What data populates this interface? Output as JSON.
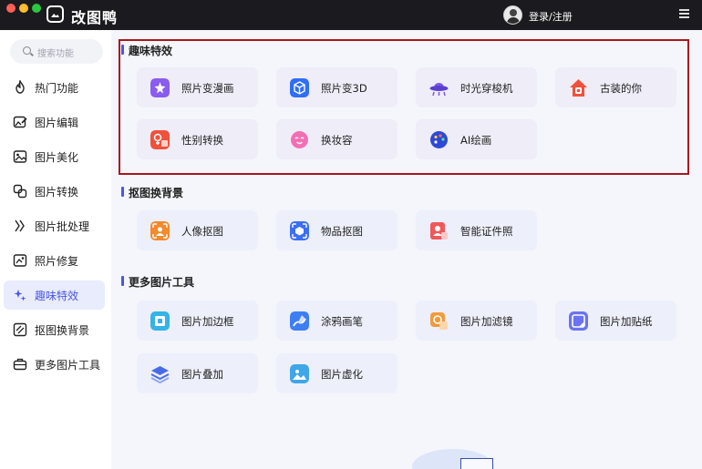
{
  "app": {
    "title": "改图鸭",
    "login_text": "登录/注册"
  },
  "icons": {
    "logo": "image-frame-icon",
    "menu": "hamburger-icon",
    "search": "search-icon"
  },
  "sidebar": {
    "search_placeholder": "搜索功能",
    "items": [
      {
        "label": "热门功能",
        "icon": "flame-icon",
        "active": false
      },
      {
        "label": "图片编辑",
        "icon": "image-edit-icon",
        "active": false
      },
      {
        "label": "图片美化",
        "icon": "image-beautify-icon",
        "active": false
      },
      {
        "label": "图片转换",
        "icon": "image-convert-icon",
        "active": false
      },
      {
        "label": "图片批处理",
        "icon": "batch-icon",
        "active": false
      },
      {
        "label": "照片修复",
        "icon": "photo-repair-icon",
        "active": false
      },
      {
        "label": "趣味特效",
        "icon": "sparkle-icon",
        "active": true
      },
      {
        "label": "抠图换背景",
        "icon": "cutout-icon",
        "active": false
      },
      {
        "label": "更多图片工具",
        "icon": "toolbox-icon",
        "active": false
      }
    ]
  },
  "sections": {
    "fun_effects": {
      "title": "趣味特效",
      "cards": [
        {
          "label": "照片变漫画",
          "icon": "comic-icon",
          "color": "#8a5cf0"
        },
        {
          "label": "照片变3D",
          "icon": "cube-3d-icon",
          "color": "#2f6df6"
        },
        {
          "label": "时光穿梭机",
          "icon": "ufo-icon",
          "color": "#7a57e8"
        },
        {
          "label": "古装的你",
          "icon": "costume-icon",
          "color": "#f0513c"
        },
        {
          "label": "性别转换",
          "icon": "gender-swap-icon",
          "color": "#f0513c"
        },
        {
          "label": "换妆容",
          "icon": "makeup-icon",
          "color": "#f36fb4"
        },
        {
          "label": "AI绘画",
          "icon": "ai-paint-icon",
          "color": "#2c49d6"
        }
      ]
    },
    "cutout": {
      "title": "抠图换背景",
      "cards": [
        {
          "label": "人像抠图",
          "icon": "portrait-cutout-icon",
          "color": "#f38a2c"
        },
        {
          "label": "物品抠图",
          "icon": "object-cutout-icon",
          "color": "#3b6ef3"
        },
        {
          "label": "智能证件照",
          "icon": "id-photo-icon",
          "color": "#f0585a"
        }
      ]
    },
    "more_tools": {
      "title": "更多图片工具",
      "cards": [
        {
          "label": "图片加边框",
          "icon": "frame-icon",
          "color": "#34b3e8"
        },
        {
          "label": "涂鸦画笔",
          "icon": "brush-icon",
          "color": "#3d7ef3"
        },
        {
          "label": "图片加滤镜",
          "icon": "filter-icon",
          "color": "#f39a3a"
        },
        {
          "label": "图片加贴纸",
          "icon": "sticker-icon",
          "color": "#6a73f0"
        },
        {
          "label": "图片叠加",
          "icon": "layers-icon",
          "color": "#4a6be8"
        },
        {
          "label": "图片虚化",
          "icon": "blur-icon",
          "color": "#3fa6e8"
        }
      ]
    }
  }
}
